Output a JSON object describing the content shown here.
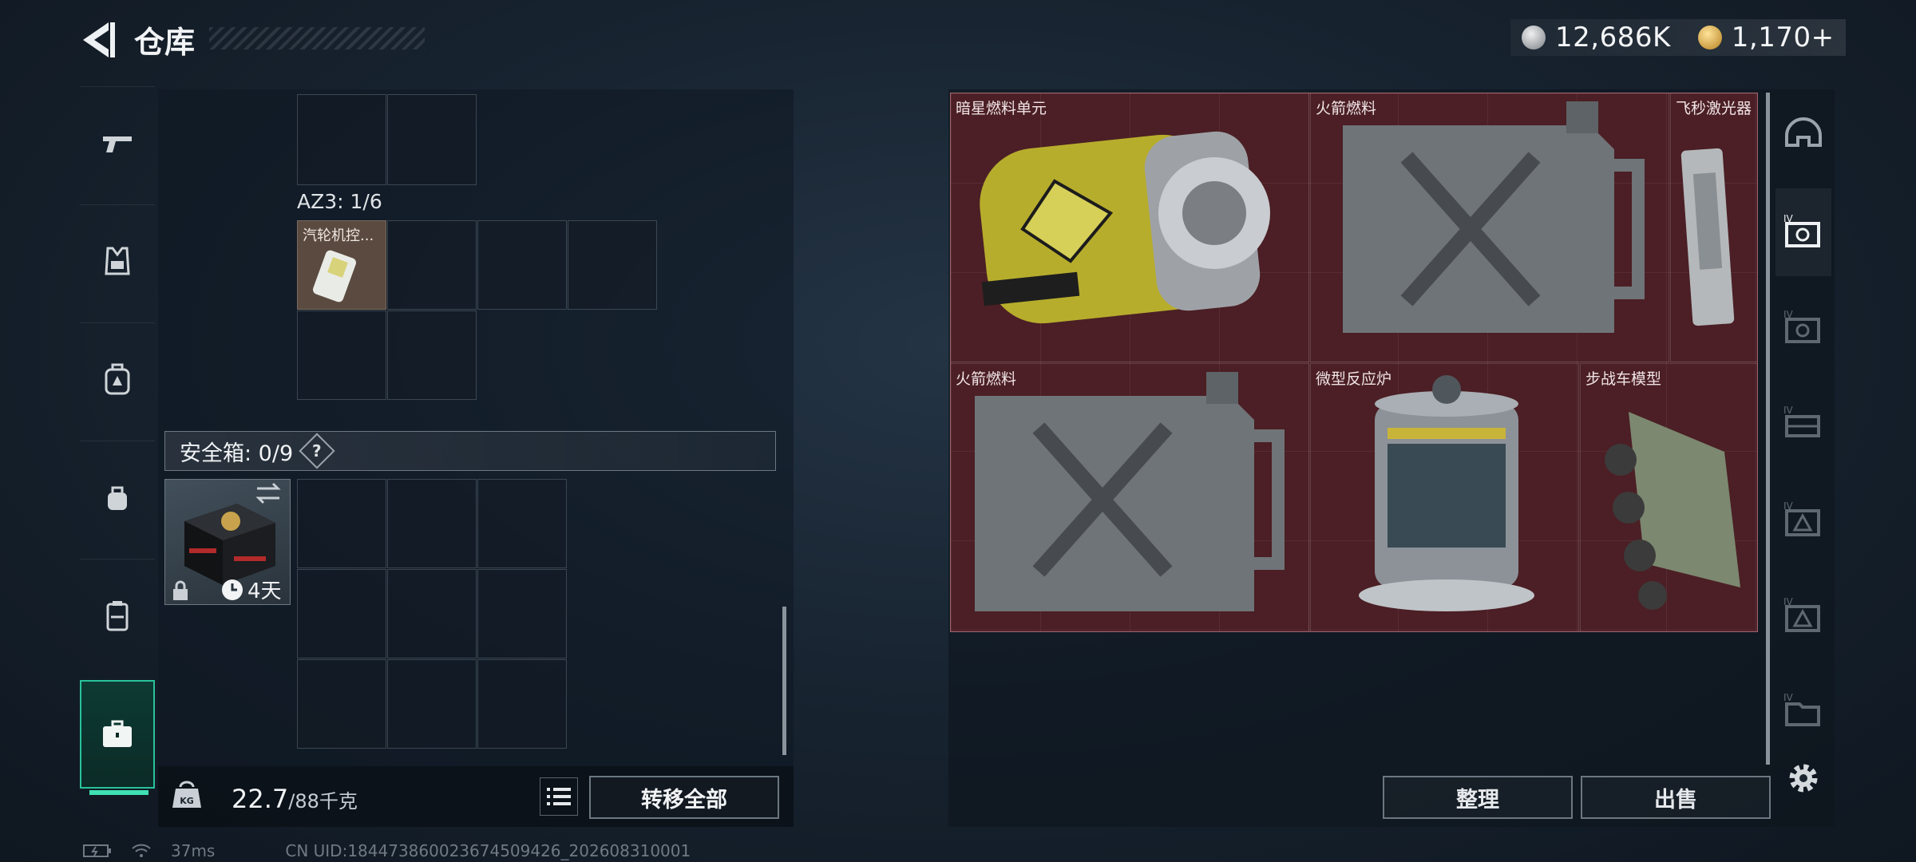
{
  "header": {
    "title": "仓库",
    "currency": [
      {
        "icon": "silver-coin-icon",
        "value": "12,686K"
      },
      {
        "icon": "gold-coin-icon",
        "value": "1,170+"
      }
    ]
  },
  "left_nav": {
    "items": [
      {
        "name": "weapons",
        "icon": "gun-icon"
      },
      {
        "name": "vest",
        "icon": "vest-icon"
      },
      {
        "name": "backpack",
        "icon": "backpack-icon"
      },
      {
        "name": "bag",
        "icon": "bag-icon"
      },
      {
        "name": "case",
        "icon": "case-icon"
      },
      {
        "name": "storage",
        "icon": "briefcase-icon",
        "active": true
      }
    ]
  },
  "inventory": {
    "az3_label": "AZ3: 1/6",
    "az3_item_name": "汽轮机控...",
    "safe_box_label": "安全箱: 0/9",
    "safe_box_help": "?",
    "safe_box_timer": "4天",
    "weight_value": "22.7",
    "weight_max": "/88千克",
    "transfer_all_label": "转移全部"
  },
  "stash": {
    "items": [
      {
        "name": "暗星燃料单元"
      },
      {
        "name": "火箭燃料"
      },
      {
        "name": "飞秒激光器"
      },
      {
        "name": "火箭燃料"
      },
      {
        "name": "微型反应炉"
      },
      {
        "name": "步战车模型"
      }
    ],
    "sort_label": "整理",
    "sell_label": "出售"
  },
  "right_nav": {
    "items": [
      {
        "icon": "helmet-icon"
      },
      {
        "icon": "tier4-safe-icon",
        "active": true
      },
      {
        "icon": "tier4-safe-icon"
      },
      {
        "icon": "tier4-container-icon"
      },
      {
        "icon": "tier4-triangle-icon"
      },
      {
        "icon": "tier4-triangle-icon"
      },
      {
        "icon": "tier4-folder-icon"
      }
    ]
  },
  "status": {
    "ping": "37ms",
    "uid": "CN UID:18447386002367450942​6_202608310001"
  }
}
